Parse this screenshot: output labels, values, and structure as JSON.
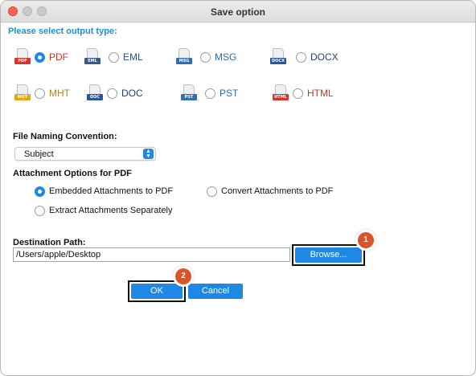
{
  "window": {
    "title": "Save option"
  },
  "output_type": {
    "label": "Please select output type:",
    "selected": "PDF",
    "options": [
      {
        "label": "PDF",
        "icon": "pdf-file-icon",
        "tag": "PDF",
        "tag_color": "#d9342b",
        "text_color": "#c0392b",
        "checked": true
      },
      {
        "label": "EML",
        "icon": "eml-file-icon",
        "tag": "EML",
        "tag_color": "#3b5a8a",
        "text_color": "#2a4f86",
        "checked": false
      },
      {
        "label": "MSG",
        "icon": "msg-file-icon",
        "tag": "MSG",
        "tag_color": "#2e6fb7",
        "text_color": "#2a6bb2",
        "checked": false
      },
      {
        "label": "DOCX",
        "icon": "docx-file-icon",
        "tag": "DOCX",
        "tag_color": "#2b579a",
        "text_color": "#1f3f7a",
        "checked": false
      },
      {
        "label": "MHT",
        "icon": "mht-file-icon",
        "tag": "MHT",
        "tag_color": "#e8a317",
        "text_color": "#b7860b",
        "checked": false
      },
      {
        "label": "DOC",
        "icon": "doc-file-icon",
        "tag": "DOC",
        "tag_color": "#2b579a",
        "text_color": "#1f3f7a",
        "checked": false
      },
      {
        "label": "PST",
        "icon": "pst-file-icon",
        "tag": "PST",
        "tag_color": "#2e6fb7",
        "text_color": "#2a6bb2",
        "checked": false
      },
      {
        "label": "HTML",
        "icon": "html-file-icon",
        "tag": "HTML",
        "tag_color": "#d9342b",
        "text_color": "#c0392b",
        "checked": false
      }
    ]
  },
  "naming": {
    "label": "File Naming Convention:",
    "value": "Subject"
  },
  "attachments": {
    "label": "Attachment Options for PDF",
    "options": [
      {
        "label": "Embedded Attachments to PDF",
        "checked": true
      },
      {
        "label": "Convert Attachments to PDF",
        "checked": false
      },
      {
        "label": "Extract Attachments Separately",
        "checked": false
      }
    ]
  },
  "destination": {
    "label": "Destination Path:",
    "value": "/Users/apple/Desktop",
    "browse_label": "Browse..."
  },
  "buttons": {
    "ok": "OK",
    "cancel": "Cancel"
  },
  "step_badges": {
    "browse": "1",
    "ok": "2"
  },
  "colors": {
    "accent": "#1e88e5",
    "section_label": "#1e90d6",
    "badge": "#d9532b"
  }
}
